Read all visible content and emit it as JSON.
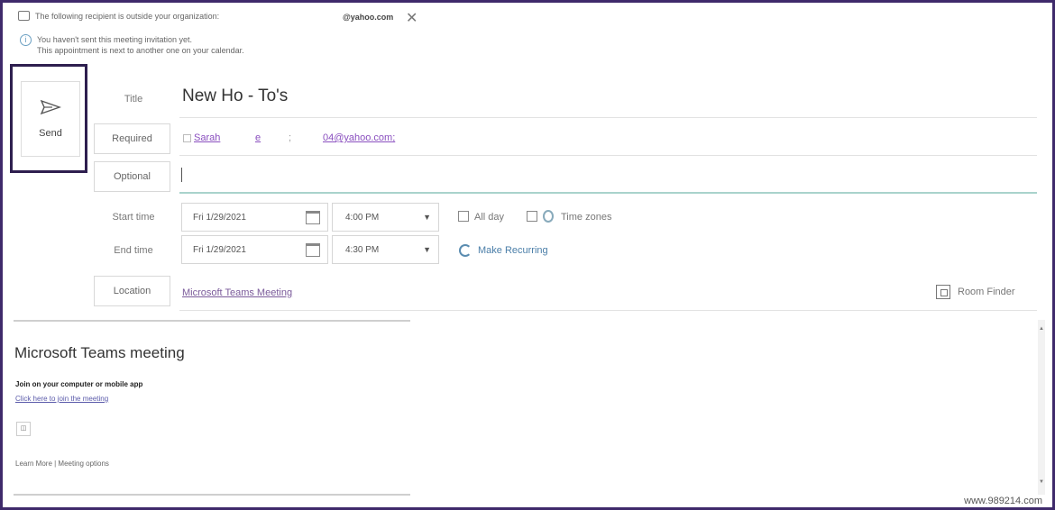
{
  "info": {
    "external_notice": "The following recipient is outside your organization:",
    "external_domain": "@yahoo.com",
    "not_sent_line1": "You haven't sent this meeting invitation yet.",
    "not_sent_line2": "This appointment is next to another one on your calendar."
  },
  "send": {
    "label": "Send"
  },
  "fields": {
    "title_label": "Title",
    "title_value": "New Ho - To's",
    "required_label": "Required",
    "required_attendees": [
      "Sarah",
      "e",
      ";",
      "04@yahoo.com;"
    ],
    "optional_label": "Optional",
    "start_label": "Start time",
    "start_date": "Fri 1/29/2021",
    "start_time": "4:00 PM",
    "end_label": "End time",
    "end_date": "Fri 1/29/2021",
    "end_time": "4:30 PM",
    "all_day": "All day",
    "time_zones": "Time zones",
    "make_recurring": "Make Recurring",
    "location_label": "Location",
    "location_value": "Microsoft Teams Meeting",
    "room_finder": "Room Finder"
  },
  "body": {
    "teams_title": "Microsoft Teams meeting",
    "join_heading": "Join on your computer or mobile app",
    "join_link": "Click here to join the meeting",
    "learn_more": "Learn More | Meeting options"
  },
  "watermark": "www.989214.com"
}
